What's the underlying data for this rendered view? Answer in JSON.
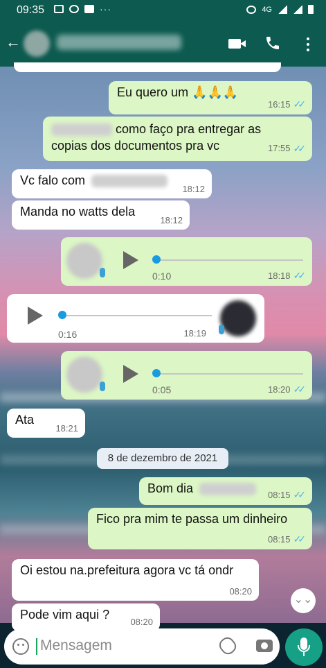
{
  "status_bar": {
    "time": "09:35",
    "network": "4G"
  },
  "header": {
    "back_symbol": "←"
  },
  "messages": [
    {
      "id": "m1",
      "dir": "out",
      "text": "Eu quero um 🙏🙏🙏",
      "time": "16:15"
    },
    {
      "id": "m2",
      "dir": "out",
      "text": "como faço pra entregar as",
      "text2": "copias dos documentos pra vc",
      "time": "17:55"
    },
    {
      "id": "m3",
      "dir": "in",
      "text": "Vc falo com",
      "time": "18:12"
    },
    {
      "id": "m4",
      "dir": "in",
      "text": "Manda no watts dela",
      "time": "18:12"
    },
    {
      "id": "v1",
      "dir": "out",
      "duration": "0:10",
      "time": "18:18"
    },
    {
      "id": "v2",
      "dir": "in",
      "duration": "0:16",
      "time": "18:19"
    },
    {
      "id": "v3",
      "dir": "out",
      "duration": "0:05",
      "time": "18:20"
    },
    {
      "id": "m5",
      "dir": "in",
      "text": "Ata",
      "time": "18:21"
    },
    {
      "id": "m6",
      "dir": "out",
      "text": "Bom dia",
      "time": "08:15"
    },
    {
      "id": "m7",
      "dir": "out",
      "text": "Fico pra mim te passa um dinheiro",
      "time": "08:15"
    },
    {
      "id": "m8",
      "dir": "in",
      "text": "Oi estou na.prefeitura agora vc tá ondr",
      "time": "08:20"
    },
    {
      "id": "m9",
      "dir": "in",
      "text": "Pode vim aqui ?",
      "time": "08:20"
    }
  ],
  "date_separator": "8 de dezembro de 2021",
  "input": {
    "placeholder": "Mensagem"
  },
  "icons": {
    "back": "arrow-left-icon",
    "video": "video-call-icon",
    "call": "phone-icon",
    "menu": "more-vert-icon",
    "emoji": "emoji-icon",
    "attach": "paperclip-icon",
    "camera": "camera-icon",
    "mic": "mic-icon",
    "scroll": "double-chevron-down-icon",
    "play": "play-icon"
  },
  "colors": {
    "header": "#0c5a50",
    "outgoing": "#dcf7c5",
    "incoming": "#ffffff",
    "read_ticks": "#4fb6ec",
    "mic_button": "#16a085"
  }
}
